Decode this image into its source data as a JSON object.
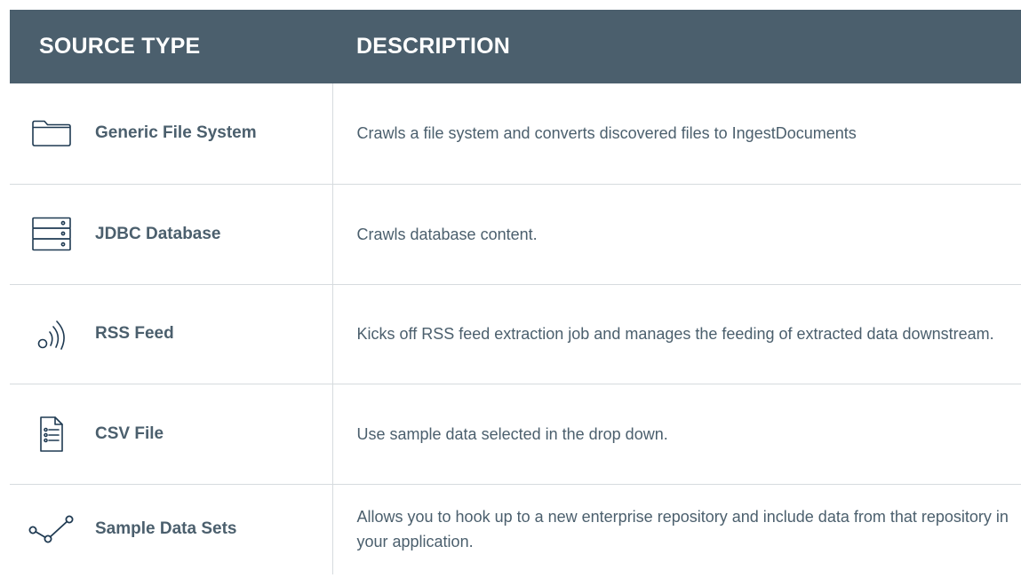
{
  "table": {
    "headers": {
      "source_type": "SOURCE TYPE",
      "description": "DESCRIPTION"
    },
    "rows": [
      {
        "icon": "folder-icon",
        "name": "Generic File System",
        "description": "Crawls a file system and converts discovered files to IngestDocuments"
      },
      {
        "icon": "database-server-icon",
        "name": "JDBC Database",
        "description": "Crawls database content."
      },
      {
        "icon": "rss-feed-icon",
        "name": "RSS Feed",
        "description": "Kicks off RSS feed extraction job and manages the feeding of extracted data downstream."
      },
      {
        "icon": "document-list-icon",
        "name": "CSV File",
        "description": "Use sample data selected in the drop down."
      },
      {
        "icon": "connected-nodes-icon",
        "name": "Sample Data Sets",
        "description": "Allows you to hook up to a new enterprise repository and include data from that repository in your application."
      }
    ]
  },
  "colors": {
    "header_background": "#4b5f6d",
    "header_text": "#ffffff",
    "body_text": "#4b5f6d",
    "icon_stroke": "#1f3a52",
    "divider": "#d6dbde"
  }
}
